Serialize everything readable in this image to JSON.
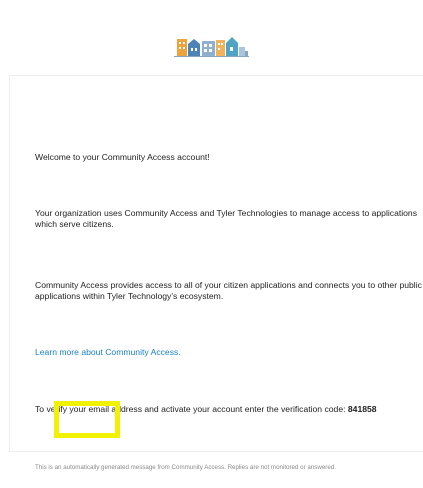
{
  "header": {
    "logo_icon": "community-access-logo"
  },
  "email": {
    "welcome": "Welcome to your Community Access account!",
    "org_text": "Your organization uses Community Access and Tyler Technologies to manage access to applications which serve citizens.",
    "ca_text": "Community Access provides access to all of your citizen applications and connects you to other public applications within Tyler Technology’s ecosystem.",
    "learn_more": "Learn more about Community Access.",
    "verify_text": "To verify your email address and activate your account enter the verification code: ",
    "code": "841858"
  },
  "footer": {
    "note": "This is an automatically generated message from Community Access. Replies are not monitored or answered."
  },
  "colors": {
    "link": "#1a7fc0",
    "highlight": "#f2f200"
  }
}
